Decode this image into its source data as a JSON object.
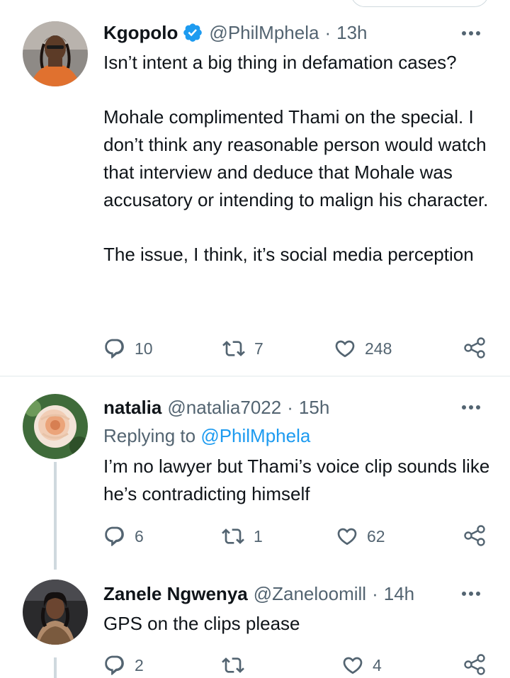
{
  "tweets": [
    {
      "name": "Kgopolo",
      "verified": true,
      "handle": "@PhilMphela",
      "separator": "·",
      "time": "13h",
      "paragraphs": [
        "Isn’t intent a big thing in defamation cases?",
        "Mohale complimented Thami on the special. I don’t think any reasonable person would watch that interview and deduce that Mohale was accusatory or intending to malign his character.",
        "The issue, I think, it’s social media perception"
      ],
      "replies": "10",
      "retweets": "7",
      "likes": "248"
    },
    {
      "name": "natalia",
      "handle": "@natalia7022",
      "separator": "·",
      "time": "15h",
      "replying_prefix": "Replying to",
      "replying_to": "@PhilMphela",
      "text": "I’m no lawyer but Thami’s voice clip sounds like he’s contradicting himself",
      "replies": "6",
      "retweets": "1",
      "likes": "62"
    },
    {
      "name": "Zanele Ngwenya",
      "handle": "@Zaneloomill",
      "separator": "·",
      "time": "14h",
      "text": "GPS on the clips please",
      "replies": "2",
      "retweets": "",
      "likes": "4"
    }
  ],
  "icons": {
    "reply": "reply-icon",
    "retweet": "retweet-icon",
    "like": "heart-icon",
    "share": "share-icon",
    "more": "more-icon",
    "verified": "verified-badge-icon"
  },
  "colors": {
    "text": "#0f1419",
    "muted": "#536471",
    "link": "#1d9bf0",
    "divider": "#eff3f4"
  }
}
